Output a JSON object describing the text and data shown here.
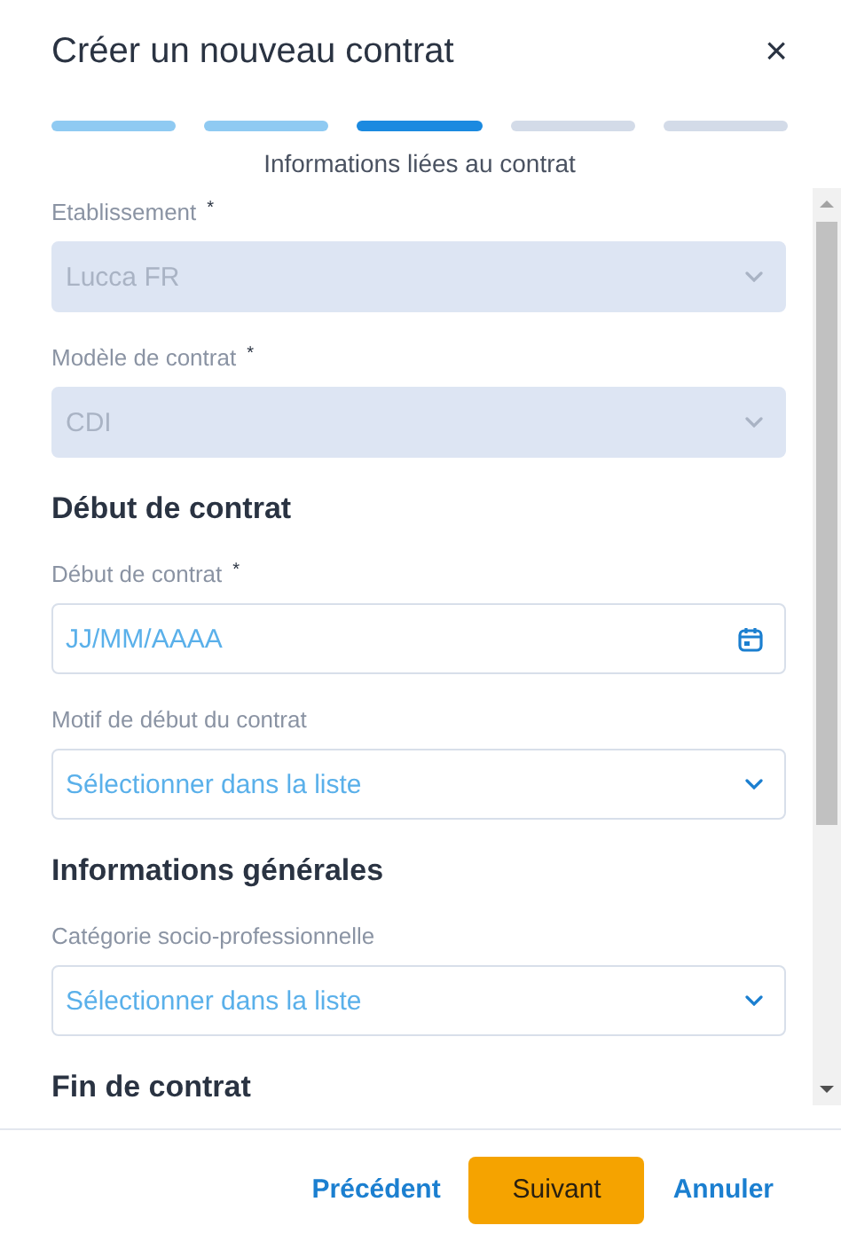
{
  "dialog": {
    "title": "Créer un nouveau contrat",
    "close": "×"
  },
  "steps": [
    {
      "kind": "done"
    },
    {
      "kind": "done"
    },
    {
      "kind": "current"
    },
    {
      "kind": "todo"
    },
    {
      "kind": "todo"
    }
  ],
  "step_caption": "Informations liées au contrat",
  "form": [
    {
      "kind": "select",
      "label": "Etablissement",
      "required_mark": "*",
      "disabled": true,
      "value": "Lucca FR"
    },
    {
      "kind": "select",
      "label": "Modèle de contrat",
      "required_mark": "*",
      "disabled": true,
      "value": "CDI"
    },
    {
      "kind": "heading",
      "text": "Début de contrat"
    },
    {
      "kind": "date",
      "label": "Début de contrat",
      "required_mark": "*",
      "disabled": false,
      "placeholder": "JJ/MM/AAAA"
    },
    {
      "kind": "select",
      "label": "Motif de début du contrat",
      "disabled": false,
      "placeholder": "Sélectionner dans la liste"
    },
    {
      "kind": "heading",
      "text": "Informations générales"
    },
    {
      "kind": "select",
      "label": "Catégorie socio-professionnelle",
      "disabled": false,
      "placeholder": "Sélectionner dans la liste"
    },
    {
      "kind": "heading",
      "text": "Fin de contrat"
    }
  ],
  "footer": {
    "buttons": [
      {
        "label": "Précédent",
        "kind": "link"
      },
      {
        "label": "Suivant",
        "kind": "primary"
      },
      {
        "label": "Annuler",
        "kind": "link"
      }
    ]
  }
}
